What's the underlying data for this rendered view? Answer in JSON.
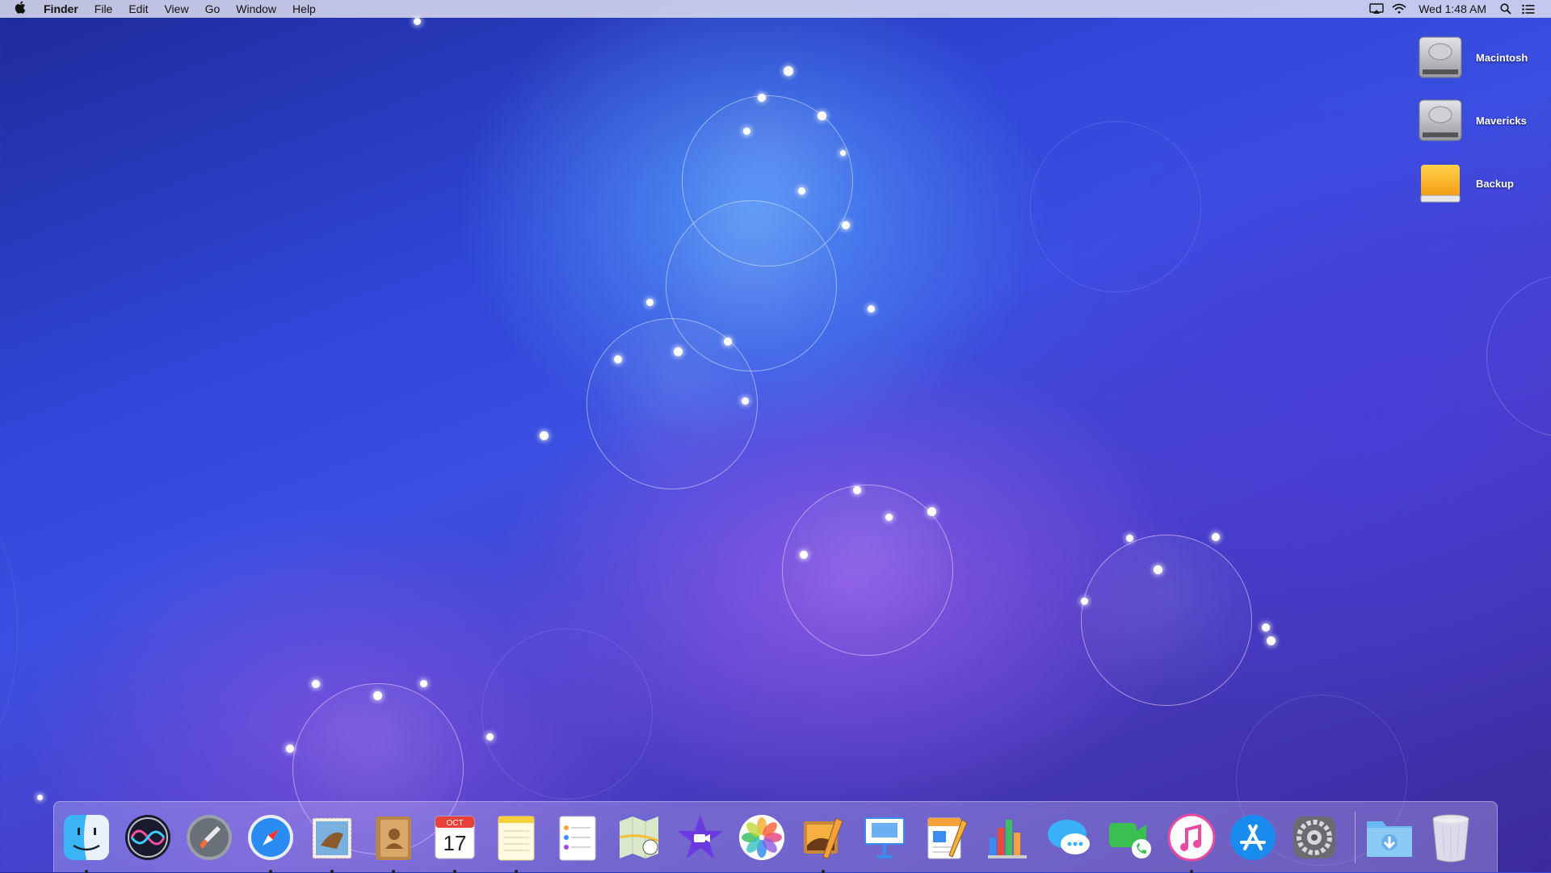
{
  "menubar": {
    "app_name": "Finder",
    "menus": [
      "File",
      "Edit",
      "View",
      "Go",
      "Window",
      "Help"
    ],
    "clock": "Wed 1:48 AM",
    "status_icons": [
      "airplay-icon",
      "wifi-icon",
      "spotlight-search-icon",
      "notification-center-icon"
    ]
  },
  "desktop": {
    "drives": [
      {
        "label": "Macintosh",
        "icon": "hard-drive-icon"
      },
      {
        "label": "Mavericks",
        "icon": "hard-drive-icon"
      },
      {
        "label": "Backup",
        "icon": "external-drive-icon"
      }
    ]
  },
  "dock": {
    "apps": [
      {
        "name": "Finder",
        "icon": "finder-icon",
        "running": true
      },
      {
        "name": "Siri",
        "icon": "siri-icon",
        "running": false
      },
      {
        "name": "Launchpad",
        "icon": "launchpad-icon",
        "running": false
      },
      {
        "name": "Safari",
        "icon": "safari-icon",
        "running": true
      },
      {
        "name": "Mail",
        "icon": "mail-icon",
        "running": true
      },
      {
        "name": "Contacts",
        "icon": "contacts-icon",
        "running": true
      },
      {
        "name": "Calendar",
        "icon": "calendar-icon",
        "running": true,
        "month": "OCT",
        "day": "17"
      },
      {
        "name": "Notes",
        "icon": "notes-icon",
        "running": true
      },
      {
        "name": "Reminders",
        "icon": "reminders-icon",
        "running": false
      },
      {
        "name": "Maps",
        "icon": "maps-icon",
        "running": false
      },
      {
        "name": "iMovie",
        "icon": "imovie-icon",
        "running": false
      },
      {
        "name": "Photos",
        "icon": "photos-icon",
        "running": false
      },
      {
        "name": "Image Capture",
        "icon": "image-capture-icon",
        "running": true
      },
      {
        "name": "Keynote",
        "icon": "keynote-icon",
        "running": false
      },
      {
        "name": "Pages",
        "icon": "pages-icon",
        "running": false
      },
      {
        "name": "Numbers",
        "icon": "numbers-icon",
        "running": false
      },
      {
        "name": "Messages",
        "icon": "messages-icon",
        "running": false
      },
      {
        "name": "FaceTime",
        "icon": "facetime-icon",
        "running": false
      },
      {
        "name": "iTunes",
        "icon": "itunes-icon",
        "running": true
      },
      {
        "name": "App Store",
        "icon": "app-store-icon",
        "running": false
      },
      {
        "name": "System Preferences",
        "icon": "system-preferences-icon",
        "running": false
      }
    ],
    "stacks": [
      {
        "name": "Downloads",
        "icon": "downloads-folder-icon"
      },
      {
        "name": "Trash",
        "icon": "trash-icon"
      }
    ]
  },
  "colors": {
    "menubar_bg": "#ececf4",
    "desktop_blue": "#2f46d6",
    "desktop_purple": "#7a4fd8"
  }
}
